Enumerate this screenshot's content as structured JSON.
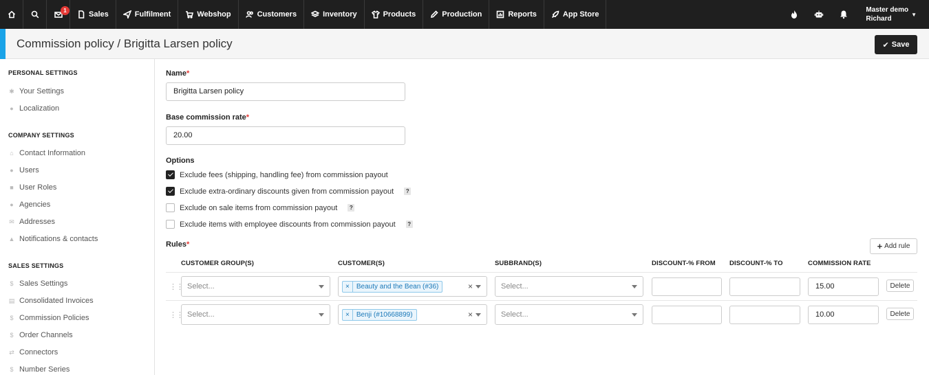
{
  "nav": {
    "notifications_count": "1",
    "items": [
      "Sales",
      "Fulfilment",
      "Webshop",
      "Customers",
      "Inventory",
      "Products",
      "Production",
      "Reports",
      "App Store"
    ],
    "user_line1": "Master demo",
    "user_line2": "Richard"
  },
  "header": {
    "title": "Commission policy / Brigitta Larsen policy",
    "save_label": "Save"
  },
  "sidebar": {
    "personal_heading": "PERSONAL SETTINGS",
    "personal": [
      "Your Settings",
      "Localization"
    ],
    "company_heading": "COMPANY SETTINGS",
    "company": [
      "Contact Information",
      "Users",
      "User Roles",
      "Agencies",
      "Addresses",
      "Notifications & contacts"
    ],
    "sales_heading": "SALES SETTINGS",
    "sales": [
      "Sales Settings",
      "Consolidated Invoices",
      "Commission Policies",
      "Order Channels",
      "Connectors",
      "Number Series"
    ]
  },
  "form": {
    "name_label": "Name",
    "name_value": "Brigitta Larsen policy",
    "rate_label": "Base commission rate",
    "rate_value": "20.00",
    "options_label": "Options",
    "options": [
      {
        "label": "Exclude fees (shipping, handling fee) from commission payout",
        "checked": true,
        "help": false
      },
      {
        "label": "Exclude extra-ordinary discounts given from commission payout",
        "checked": true,
        "help": true
      },
      {
        "label": "Exclude on sale items from commission payout",
        "checked": false,
        "help": true
      },
      {
        "label": "Exclude items with employee discounts from commission payout",
        "checked": false,
        "help": true
      }
    ],
    "help_glyph": "?",
    "rules_label": "Rules",
    "add_rule_label": "Add rule"
  },
  "rules_table": {
    "columns": [
      "CUSTOMER GROUP(S)",
      "CUSTOMER(S)",
      "SUBBRAND(S)",
      "DISCOUNT-% FROM",
      "DISCOUNT-% TO",
      "COMMISSION RATE"
    ],
    "select_placeholder": "Select...",
    "delete_label": "Delete",
    "rows": [
      {
        "customer_group": "",
        "customer_tag": "Beauty and the Bean (#36)",
        "subbrand": "",
        "discount_from": "",
        "discount_to": "",
        "commission_rate": "15.00"
      },
      {
        "customer_group": "",
        "customer_tag": "Benji (#10668899)",
        "subbrand": "",
        "discount_from": "",
        "discount_to": "",
        "commission_rate": "10.00"
      }
    ]
  }
}
